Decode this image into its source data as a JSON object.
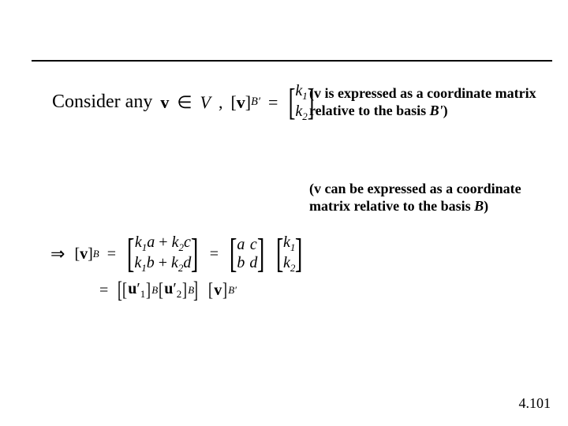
{
  "row1": {
    "consider": "Consider any",
    "v": "v",
    "in": "∈",
    "V": "V",
    "comma": ",",
    "lbrv": "[",
    "v2": "v",
    "rbrv": "]",
    "Bprime": "B′",
    "eq": "=",
    "k1": "k",
    "one": "1",
    "k2": "k",
    "two": "2"
  },
  "note1_a": "(",
  "note1_b": "v",
  "note1_c": " is expressed as a coordinate matrix relative to the basis ",
  "note1_d": "B'",
  "note1_e": ")",
  "note2_a": "(",
  "note2_b": "v",
  "note2_c": " can be expressed as a coordinate matrix relative to the basis ",
  "note2_d": "B",
  "note2_e": ")",
  "eq": {
    "imply": "⇒",
    "lbr": "[",
    "v": "v",
    "rbr": "]",
    "B": "B",
    "eq": "=",
    "r1c1_a": "k",
    "r1c1_b": "1",
    "r1c1_c": "a",
    "r1c1_plus": " + ",
    "r1c1_d": "k",
    "r1c1_e": "2",
    "r1c1_f": "c",
    "r2c1_a": "k",
    "r2c1_b": "1",
    "r2c1_c": "b",
    "r2c1_plus": " + ",
    "r2c1_d": "k",
    "r2c1_e": "2",
    "r2c1_f": "d",
    "m2_11": "a",
    "m2_12": "c",
    "m2_21": "b",
    "m2_22": "d",
    "k1": "k",
    "one": "1",
    "k2": "k",
    "two": "2",
    "line2_eq": "=",
    "u1": "u",
    "u1p": "′",
    "u1s": "1",
    "u2": "u",
    "u2p": "′",
    "u2s": "2",
    "Bprime": "B′"
  },
  "pagenum": "4.101"
}
